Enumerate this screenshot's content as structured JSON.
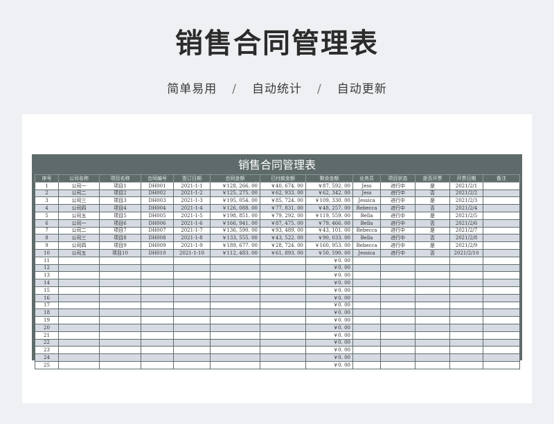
{
  "page": {
    "title": "销售合同管理表",
    "features": [
      "简单易用",
      "自动统计",
      "自动更新"
    ],
    "separator": "/"
  },
  "sheet": {
    "title": "销售合同管理表",
    "header_bg": "#5e6b6a",
    "stripe_color": "#d6dbe3",
    "columns": [
      "序号",
      "公司名称",
      "项目名称",
      "合同编号",
      "签订日期",
      "合同金额",
      "已付款金额",
      "剩余金额",
      "业务员",
      "项目状态",
      "是否开票",
      "开票日期",
      "备注"
    ],
    "rows": [
      [
        "1",
        "公司一",
        "项目1",
        "DH001",
        "2021-1-1",
        "￥128, 266. 00",
        "￥40, 674. 00",
        "￥87, 592. 00",
        "Jess",
        "进行中",
        "是",
        "2021/2/1",
        ""
      ],
      [
        "2",
        "公司二",
        "项目2",
        "DH002",
        "2021-1-2",
        "￥125, 275. 00",
        "￥62, 933. 00",
        "￥62, 342. 00",
        "Jess",
        "进行中",
        "否",
        "2021/2/2",
        ""
      ],
      [
        "3",
        "公司三",
        "项目3",
        "DH003",
        "2021-1-3",
        "￥195, 054. 00",
        "￥85, 724. 00",
        "￥109, 330. 00",
        "Jessica",
        "进行中",
        "是",
        "2021/2/3",
        ""
      ],
      [
        "4",
        "公司四",
        "项目4",
        "DH004",
        "2021-1-4",
        "￥126, 088. 00",
        "￥77, 831. 00",
        "￥48, 257. 00",
        "Rebecca",
        "进行中",
        "否",
        "2021/2/4",
        ""
      ],
      [
        "5",
        "公司五",
        "项目5",
        "DH005",
        "2021-1-5",
        "￥198, 851. 00",
        "￥79, 292. 00",
        "￥119, 559. 00",
        "Bella",
        "进行中",
        "是",
        "2021/2/5",
        ""
      ],
      [
        "6",
        "公司一",
        "项目6",
        "DH006",
        "2021-1-6",
        "￥166, 941. 00",
        "￥87, 475. 00",
        "￥79, 466. 00",
        "Bella",
        "进行中",
        "否",
        "2021/2/6",
        ""
      ],
      [
        "7",
        "公司二",
        "项目7",
        "DH007",
        "2021-1-7",
        "￥136, 590. 00",
        "￥93, 489. 00",
        "￥43, 101. 00",
        "Rebecca",
        "进行中",
        "是",
        "2021/2/7",
        ""
      ],
      [
        "8",
        "公司三",
        "项目8",
        "DH008",
        "2021-1-8",
        "￥133, 555. 00",
        "￥43, 522. 00",
        "￥90, 033. 00",
        "Bella",
        "进行中",
        "否",
        "2021/2/8",
        ""
      ],
      [
        "9",
        "公司四",
        "项目9",
        "DH009",
        "2021-1-9",
        "￥189, 677. 00",
        "￥28, 724. 00",
        "￥160, 953. 00",
        "Rebecca",
        "进行中",
        "是",
        "2021/2/9",
        ""
      ],
      [
        "10",
        "公司五",
        "项目10",
        "DH010",
        "2021-1-10",
        "￥112, 483. 00",
        "￥61, 893. 00",
        "￥50, 590. 00",
        "Jessica",
        "进行中",
        "否",
        "2021/2/10",
        ""
      ],
      [
        "11",
        "",
        "",
        "",
        "",
        "",
        "",
        "￥0. 00",
        "",
        "",
        "",
        "",
        ""
      ],
      [
        "12",
        "",
        "",
        "",
        "",
        "",
        "",
        "￥0. 00",
        "",
        "",
        "",
        "",
        ""
      ],
      [
        "13",
        "",
        "",
        "",
        "",
        "",
        "",
        "￥0. 00",
        "",
        "",
        "",
        "",
        ""
      ],
      [
        "14",
        "",
        "",
        "",
        "",
        "",
        "",
        "￥0. 00",
        "",
        "",
        "",
        "",
        ""
      ],
      [
        "15",
        "",
        "",
        "",
        "",
        "",
        "",
        "￥0. 00",
        "",
        "",
        "",
        "",
        ""
      ],
      [
        "16",
        "",
        "",
        "",
        "",
        "",
        "",
        "￥0. 00",
        "",
        "",
        "",
        "",
        ""
      ],
      [
        "17",
        "",
        "",
        "",
        "",
        "",
        "",
        "￥0. 00",
        "",
        "",
        "",
        "",
        ""
      ],
      [
        "18",
        "",
        "",
        "",
        "",
        "",
        "",
        "￥0. 00",
        "",
        "",
        "",
        "",
        ""
      ],
      [
        "19",
        "",
        "",
        "",
        "",
        "",
        "",
        "￥0. 00",
        "",
        "",
        "",
        "",
        ""
      ],
      [
        "20",
        "",
        "",
        "",
        "",
        "",
        "",
        "￥0. 00",
        "",
        "",
        "",
        "",
        ""
      ],
      [
        "21",
        "",
        "",
        "",
        "",
        "",
        "",
        "￥0. 00",
        "",
        "",
        "",
        "",
        ""
      ],
      [
        "22",
        "",
        "",
        "",
        "",
        "",
        "",
        "￥0. 00",
        "",
        "",
        "",
        "",
        ""
      ],
      [
        "23",
        "",
        "",
        "",
        "",
        "",
        "",
        "￥0. 00",
        "",
        "",
        "",
        "",
        ""
      ],
      [
        "24",
        "",
        "",
        "",
        "",
        "",
        "",
        "￥0. 00",
        "",
        "",
        "",
        "",
        ""
      ],
      [
        "25",
        "",
        "",
        "",
        "",
        "",
        "",
        "￥0. 00",
        "",
        "",
        "",
        "",
        ""
      ]
    ]
  }
}
